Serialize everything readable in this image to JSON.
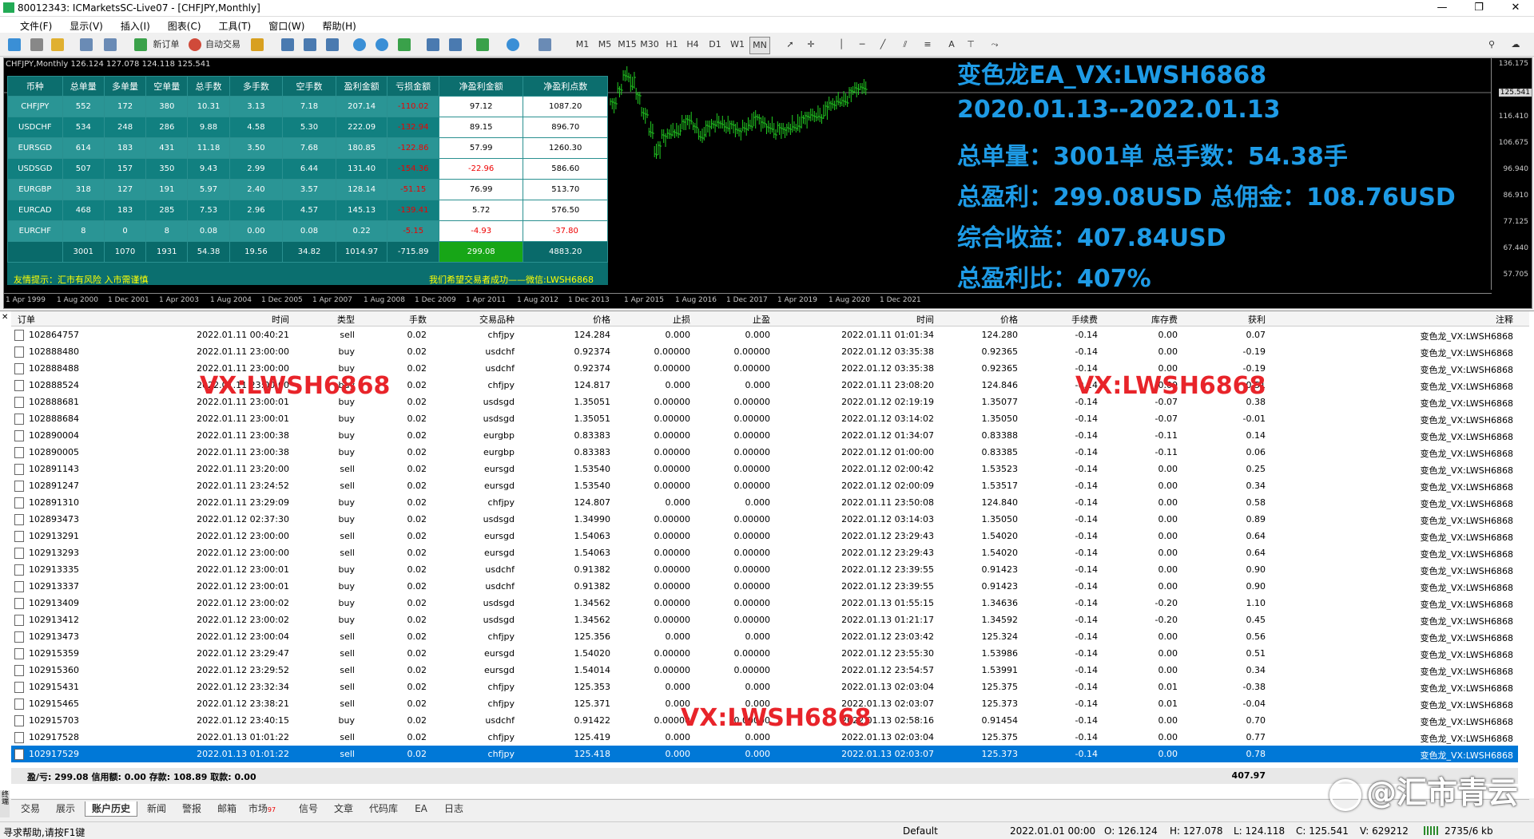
{
  "window": {
    "title": "80012343: ICMarketsSC-Live07 - [CHFJPY,Monthly]"
  },
  "menu": [
    "文件(F)",
    "显示(V)",
    "插入(I)",
    "图表(C)",
    "工具(T)",
    "窗口(W)",
    "帮助(H)"
  ],
  "toolbar": {
    "new_order": "新订单",
    "auto_trading": "自动交易",
    "timeframes": [
      "M1",
      "M5",
      "M15",
      "M30",
      "H1",
      "H4",
      "D1",
      "W1",
      "MN"
    ]
  },
  "chart": {
    "header": "CHFJPY,Monthly  126.124 127.078 124.118 125.541",
    "price_ticks": [
      "136.175",
      "125.541",
      "116.410",
      "106.675",
      "96.940",
      "86.910",
      "77.125",
      "67.440",
      "57.705"
    ],
    "current_price": "125.541",
    "time_ticks": [
      "1 Apr 1999",
      "1 Aug 2000",
      "1 Dec 2001",
      "1 Apr 2003",
      "1 Aug 2004",
      "1 Dec 2005",
      "1 Apr 2007",
      "1 Aug 2008",
      "1 Dec 2009",
      "1 Apr 2011",
      "1 Aug 2012",
      "1 Dec 2013",
      "1 Apr 2015",
      "1 Aug 2016",
      "1 Dec 2017",
      "1 Apr 2019",
      "1 Aug 2020",
      "1 Dec 2021"
    ]
  },
  "stats": {
    "headers": [
      "币种",
      "总单量",
      "多单量",
      "空单量",
      "总手数",
      "多手数",
      "空手数",
      "盈利金额",
      "亏损金额",
      "净盈利金额",
      "净盈利点数"
    ],
    "rows": [
      [
        "CHFJPY",
        "552",
        "172",
        "380",
        "10.31",
        "3.13",
        "7.18",
        "207.14",
        "-110.02",
        "97.12",
        "1087.20"
      ],
      [
        "USDCHF",
        "534",
        "248",
        "286",
        "9.88",
        "4.58",
        "5.30",
        "222.09",
        "-132.94",
        "89.15",
        "896.70"
      ],
      [
        "EURSGD",
        "614",
        "183",
        "431",
        "11.18",
        "3.50",
        "7.68",
        "180.85",
        "-122.86",
        "57.99",
        "1260.30"
      ],
      [
        "USDSGD",
        "507",
        "157",
        "350",
        "9.43",
        "2.99",
        "6.44",
        "131.40",
        "-154.36",
        "-22.96",
        "586.60"
      ],
      [
        "EURGBP",
        "318",
        "127",
        "191",
        "5.97",
        "2.40",
        "3.57",
        "128.14",
        "-51.15",
        "76.99",
        "513.70"
      ],
      [
        "EURCAD",
        "468",
        "183",
        "285",
        "7.53",
        "2.96",
        "4.57",
        "145.13",
        "-139.41",
        "5.72",
        "576.50"
      ],
      [
        "EURCHF",
        "8",
        "0",
        "8",
        "0.08",
        "0.00",
        "0.08",
        "0.22",
        "-5.15",
        "-4.93",
        "-37.80"
      ]
    ],
    "total": [
      "",
      "3001",
      "1070",
      "1931",
      "54.38",
      "19.56",
      "34.82",
      "1014.97",
      "-715.89",
      "299.08",
      "4883.20"
    ],
    "tip_left": "友情提示：汇市有风险 入市需谨慎",
    "tip_right": "我们希望交易者成功——微信:LWSH6868"
  },
  "overlay_lines": [
    "变色龙EA_VX:LWSH6868",
    "2020.01.13--2022.01.13",
    "总单量：3001单 总手数：54.38手",
    "总盈利：299.08USD 总佣金：108.76USD",
    "综合收益：407.84USD",
    "总盈利比：407%"
  ],
  "history": {
    "columns": [
      "订单",
      "时间",
      "类型",
      "手数",
      "交易品种",
      "价格",
      "止损",
      "止盈",
      "时间",
      "价格",
      "手续费",
      "库存费",
      "获利",
      "注释"
    ],
    "rows": [
      [
        "102864757",
        "2022.01.11 00:40:21",
        "sell",
        "0.02",
        "chfjpy",
        "124.284",
        "0.000",
        "0.000",
        "2022.01.11 01:01:34",
        "124.280",
        "-0.14",
        "0.00",
        "0.07",
        "变色龙_VX:LWSH6868"
      ],
      [
        "102888480",
        "2022.01.11 23:00:00",
        "buy",
        "0.02",
        "usdchf",
        "0.92374",
        "0.00000",
        "0.00000",
        "2022.01.12 03:35:38",
        "0.92365",
        "-0.14",
        "0.00",
        "-0.19",
        "变色龙_VX:LWSH6868"
      ],
      [
        "102888488",
        "2022.01.11 23:00:00",
        "buy",
        "0.02",
        "usdchf",
        "0.92374",
        "0.00000",
        "0.00000",
        "2022.01.12 03:35:38",
        "0.92365",
        "-0.14",
        "0.00",
        "-0.19",
        "变色龙_VX:LWSH6868"
      ],
      [
        "102888524",
        "2022.01.11 23:00:00",
        "buy",
        "0.02",
        "chfjpy",
        "124.817",
        "0.000",
        "0.000",
        "2022.01.11 23:08:20",
        "124.846",
        "-0.14",
        "0.00",
        "0.51",
        "变色龙_VX:LWSH6868"
      ],
      [
        "102888681",
        "2022.01.11 23:00:01",
        "buy",
        "0.02",
        "usdsgd",
        "1.35051",
        "0.00000",
        "0.00000",
        "2022.01.12 02:19:19",
        "1.35077",
        "-0.14",
        "-0.07",
        "0.38",
        "变色龙_VX:LWSH6868"
      ],
      [
        "102888684",
        "2022.01.11 23:00:01",
        "buy",
        "0.02",
        "usdsgd",
        "1.35051",
        "0.00000",
        "0.00000",
        "2022.01.12 03:14:02",
        "1.35050",
        "-0.14",
        "-0.07",
        "-0.01",
        "变色龙_VX:LWSH6868"
      ],
      [
        "102890004",
        "2022.01.11 23:00:38",
        "buy",
        "0.02",
        "eurgbp",
        "0.83383",
        "0.00000",
        "0.00000",
        "2022.01.12 01:34:07",
        "0.83388",
        "-0.14",
        "-0.11",
        "0.14",
        "变色龙_VX:LWSH6868"
      ],
      [
        "102890005",
        "2022.01.11 23:00:38",
        "buy",
        "0.02",
        "eurgbp",
        "0.83383",
        "0.00000",
        "0.00000",
        "2022.01.12 01:00:00",
        "0.83385",
        "-0.14",
        "-0.11",
        "0.06",
        "变色龙_VX:LWSH6868"
      ],
      [
        "102891143",
        "2022.01.11 23:20:00",
        "sell",
        "0.02",
        "eursgd",
        "1.53540",
        "0.00000",
        "0.00000",
        "2022.01.12 02:00:42",
        "1.53523",
        "-0.14",
        "0.00",
        "0.25",
        "变色龙_VX:LWSH6868"
      ],
      [
        "102891247",
        "2022.01.11 23:24:52",
        "sell",
        "0.02",
        "eursgd",
        "1.53540",
        "0.00000",
        "0.00000",
        "2022.01.12 02:00:09",
        "1.53517",
        "-0.14",
        "0.00",
        "0.34",
        "变色龙_VX:LWSH6868"
      ],
      [
        "102891310",
        "2022.01.11 23:29:09",
        "buy",
        "0.02",
        "chfjpy",
        "124.807",
        "0.000",
        "0.000",
        "2022.01.11 23:50:08",
        "124.840",
        "-0.14",
        "0.00",
        "0.58",
        "变色龙_VX:LWSH6868"
      ],
      [
        "102893473",
        "2022.01.12 02:37:30",
        "buy",
        "0.02",
        "usdsgd",
        "1.34990",
        "0.00000",
        "0.00000",
        "2022.01.12 03:14:03",
        "1.35050",
        "-0.14",
        "0.00",
        "0.89",
        "变色龙_VX:LWSH6868"
      ],
      [
        "102913291",
        "2022.01.12 23:00:00",
        "sell",
        "0.02",
        "eursgd",
        "1.54063",
        "0.00000",
        "0.00000",
        "2022.01.12 23:29:43",
        "1.54020",
        "-0.14",
        "0.00",
        "0.64",
        "变色龙_VX:LWSH6868"
      ],
      [
        "102913293",
        "2022.01.12 23:00:00",
        "sell",
        "0.02",
        "eursgd",
        "1.54063",
        "0.00000",
        "0.00000",
        "2022.01.12 23:29:43",
        "1.54020",
        "-0.14",
        "0.00",
        "0.64",
        "变色龙_VX:LWSH6868"
      ],
      [
        "102913335",
        "2022.01.12 23:00:01",
        "buy",
        "0.02",
        "usdchf",
        "0.91382",
        "0.00000",
        "0.00000",
        "2022.01.12 23:39:55",
        "0.91423",
        "-0.14",
        "0.00",
        "0.90",
        "变色龙_VX:LWSH6868"
      ],
      [
        "102913337",
        "2022.01.12 23:00:01",
        "buy",
        "0.02",
        "usdchf",
        "0.91382",
        "0.00000",
        "0.00000",
        "2022.01.12 23:39:55",
        "0.91423",
        "-0.14",
        "0.00",
        "0.90",
        "变色龙_VX:LWSH6868"
      ],
      [
        "102913409",
        "2022.01.12 23:00:02",
        "buy",
        "0.02",
        "usdsgd",
        "1.34562",
        "0.00000",
        "0.00000",
        "2022.01.13 01:55:15",
        "1.34636",
        "-0.14",
        "-0.20",
        "1.10",
        "变色龙_VX:LWSH6868"
      ],
      [
        "102913412",
        "2022.01.12 23:00:02",
        "buy",
        "0.02",
        "usdsgd",
        "1.34562",
        "0.00000",
        "0.00000",
        "2022.01.13 01:21:17",
        "1.34592",
        "-0.14",
        "-0.20",
        "0.45",
        "变色龙_VX:LWSH6868"
      ],
      [
        "102913473",
        "2022.01.12 23:00:04",
        "sell",
        "0.02",
        "chfjpy",
        "125.356",
        "0.000",
        "0.000",
        "2022.01.12 23:03:42",
        "125.324",
        "-0.14",
        "0.00",
        "0.56",
        "变色龙_VX:LWSH6868"
      ],
      [
        "102915359",
        "2022.01.12 23:29:47",
        "sell",
        "0.02",
        "eursgd",
        "1.54020",
        "0.00000",
        "0.00000",
        "2022.01.12 23:55:30",
        "1.53986",
        "-0.14",
        "0.00",
        "0.51",
        "变色龙_VX:LWSH6868"
      ],
      [
        "102915360",
        "2022.01.12 23:29:52",
        "sell",
        "0.02",
        "eursgd",
        "1.54014",
        "0.00000",
        "0.00000",
        "2022.01.12 23:54:57",
        "1.53991",
        "-0.14",
        "0.00",
        "0.34",
        "变色龙_VX:LWSH6868"
      ],
      [
        "102915431",
        "2022.01.12 23:32:34",
        "sell",
        "0.02",
        "chfjpy",
        "125.353",
        "0.000",
        "0.000",
        "2022.01.13 02:03:04",
        "125.375",
        "-0.14",
        "0.01",
        "-0.38",
        "变色龙_VX:LWSH6868"
      ],
      [
        "102915465",
        "2022.01.12 23:38:21",
        "sell",
        "0.02",
        "chfjpy",
        "125.371",
        "0.000",
        "0.000",
        "2022.01.13 02:03:07",
        "125.373",
        "-0.14",
        "0.01",
        "-0.04",
        "变色龙_VX:LWSH6868"
      ],
      [
        "102915703",
        "2022.01.12 23:40:15",
        "buy",
        "0.02",
        "usdchf",
        "0.91422",
        "0.00000",
        "0.00000",
        "2022.01.13 02:58:16",
        "0.91454",
        "-0.14",
        "0.00",
        "0.70",
        "变色龙_VX:LWSH6868"
      ],
      [
        "102917528",
        "2022.01.13 01:01:22",
        "sell",
        "0.02",
        "chfjpy",
        "125.419",
        "0.000",
        "0.000",
        "2022.01.13 02:03:04",
        "125.375",
        "-0.14",
        "0.00",
        "0.77",
        "变色龙_VX:LWSH6868"
      ],
      [
        "102917529",
        "2022.01.13 01:01:22",
        "sell",
        "0.02",
        "chfjpy",
        "125.418",
        "0.000",
        "0.000",
        "2022.01.13 02:03:07",
        "125.373",
        "-0.14",
        "0.00",
        "0.78",
        "变色龙_VX:LWSH6868"
      ]
    ],
    "summary": "盈/亏: 299.08  信用额: 0.00  存款: 108.89  取款: 0.00",
    "summary_total": "407.97"
  },
  "watermarks": [
    "VX:LWSH6868",
    "VX:LWSH6868",
    "VX:LWSH6868"
  ],
  "tabs": {
    "items": [
      "交易",
      "展示",
      "账户历史",
      "新闻",
      "警报",
      "邮箱",
      "市场",
      "信号",
      "文章",
      "代码库",
      "EA",
      "日志"
    ],
    "market_badge": "97",
    "active": "账户历史"
  },
  "side_label": "终端",
  "status": {
    "help": "寻求帮助,请按F1键",
    "profile": "Default",
    "datetime": "2022.01.01 00:00",
    "open": "O: 126.124",
    "high": "H: 127.078",
    "low": "L: 124.118",
    "close": "C: 125.541",
    "volume": "V: 629212",
    "traffic": "2735/6 kb"
  },
  "brand_watermark": "@汇市青云",
  "colors": {
    "accent": "#1e9be6",
    "selection": "#0078d7",
    "panel": "#0b6f6f",
    "candle": "#22cc22",
    "watermark": "#e8242a"
  },
  "chart_data": {
    "type": "bar",
    "title": "CHFJPY,Monthly",
    "open": 126.124,
    "high": 127.078,
    "low": 124.118,
    "close": 125.541,
    "ylim": [
      57.705,
      136.175
    ]
  }
}
